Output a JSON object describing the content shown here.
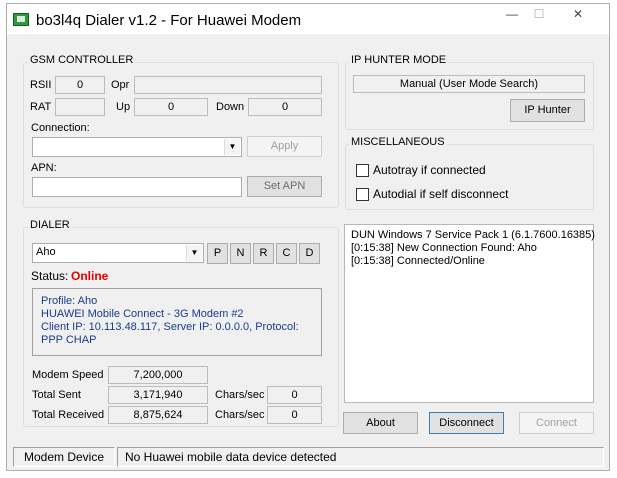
{
  "window": {
    "title": "bo3l4q Dialer v1.2 - For Huawei Modem",
    "caption_buttons": {
      "minimize": "—",
      "maximize": "☐",
      "close": "✕"
    }
  },
  "gsm": {
    "title": "GSM CONTROLLER",
    "rssi_label": "RSII",
    "rssi_value": "0",
    "opr_label": "Opr",
    "opr_value": "",
    "rat_label": "RAT",
    "rat_value": "",
    "up_label": "Up",
    "up_value": "0",
    "down_label": "Down",
    "down_value": "0",
    "connection_label": "Connection:",
    "connection_value": "",
    "apply_label": "Apply",
    "apn_label": "APN:",
    "apn_value": "",
    "set_apn_label": "Set APN"
  },
  "ip_hunter": {
    "title": "IP HUNTER MODE",
    "mode_value": "Manual (User Mode Search)",
    "button_label": "IP Hunter"
  },
  "misc": {
    "title": "MISCELLANEOUS",
    "autotray_label": "Autotray if connected",
    "autotray_checked": false,
    "autodial_label": "Autodial if self disconnect",
    "autodial_checked": false
  },
  "dialer": {
    "title": "DIALER",
    "profile_selected": "Aho",
    "buttons": [
      "P",
      "N",
      "R",
      "C",
      "D"
    ],
    "status_label": "Status:",
    "status_value": "Online",
    "status_color": "#e60000",
    "info_lines": [
      "Profile: Aho",
      "HUAWEI Mobile Connect - 3G Modem #2",
      "Client IP: 10.113.48.117,  Server IP: 0.0.0.0,  Protocol:",
      "PPP CHAP"
    ],
    "modem_speed_label": "Modem Speed",
    "modem_speed_value": "7,200,000",
    "total_sent_label": "Total Sent",
    "total_sent_value": "3,171,940",
    "total_received_label": "Total Received",
    "total_received_value": "8,875,624",
    "chars_sec_label": "Chars/sec",
    "sent_rate_value": "0",
    "received_rate_value": "0"
  },
  "log": {
    "lines": [
      "DUN Windows 7 Service Pack 1 (6.1.7600.16385)",
      "[0:15:38]  New Connection Found: Aho",
      "[0:15:38]  Connected/Online"
    ]
  },
  "actions": {
    "about_label": "About",
    "disconnect_label": "Disconnect",
    "connect_label": "Connect"
  },
  "statusbar": {
    "device_label": "Modem Device",
    "device_status": "No Huawei mobile data device detected"
  }
}
